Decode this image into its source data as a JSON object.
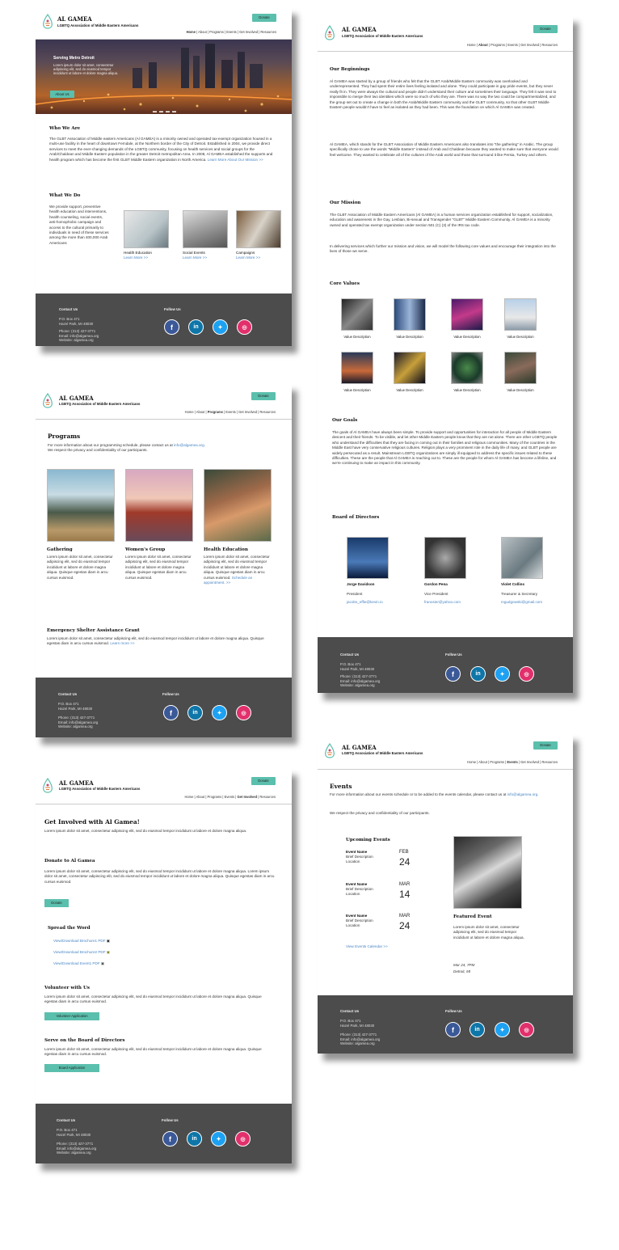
{
  "org": {
    "name": "AL GAMEA",
    "subtitle": "LGBTQ Association of Middle Eastern Americans",
    "donate": "Donate"
  },
  "nav": [
    "Home",
    "About",
    "Programs",
    "Events",
    "Get Involved",
    "Resources"
  ],
  "home": {
    "hero_title": "Serving Metro Detroit",
    "hero_text": "Lorem ipsum dolor sit amet, consectetur adipiscing elit, sed do eiusmod tempor incididunt ut labore et dolore magna aliqua.",
    "hero_button": "About Us",
    "who_title": "Who We Are",
    "who_text": "The GLBT Association of Middle eastern Americans (Al GAMEA) is a minority owned and operated tax-exempt organization housed in a multi-use facility in the heart of downtown Ferndale, at the Northern border of the City of Detroit. Established in 2004, we provide direct services to meet the ever-changing demands of the LGBTQ community, focusing on health services and social groups for the Arab/Chaldean and Middle Eastern population in the greater Detroit metropolitan Area. In 2008, Al GAMEA established the supports and health program which has become the first GLBT Middle Eastern organization in North America.",
    "who_link": "Learn More About Our Mission >>",
    "what_title": "What We Do",
    "what_text": "We provide support, preventive health education and interventions, health counseling, social events, anti-homophobic campaign and access to the cultural primarily to individuals in need of these services among the more than 400,000 Arab Americans",
    "cards": [
      {
        "label": "Health Education",
        "link": "Learn More >>"
      },
      {
        "label": "Social Events",
        "link": "Learn More >>"
      },
      {
        "label": "Campaigns",
        "link": "Learn More >>"
      }
    ]
  },
  "about": {
    "beginnings_title": "Our Beginnings",
    "beginnings_p1": "Al GAMEA was started by a group of friends who felt that the GLBT Arab/Middle Eastern community was overlooked and underrepresented. They had spent their entire lives feeling isolated and alone. They could participate in gay pride events, but they never really fit in. They were always the cultural and people didn't understand their culture and sometimes their language. They felt it was next to impossible to merge their two identities which were so much of who they are. There was no way the two could be compartmentalized, and the group set out to create a change in both the Arab/Middle Eastern community and the GLBT community, so that other GLBT Middle Eastern people wouldn't have to feel as isolated as they had been. This was the foundation on which Al GAMEA was created.",
    "beginnings_p2": "Al GAMEA, which stands for the GLBT Association of Middle Eastern Americans also translates into \"the gathering\" in Arabic. The group specifically chose to use the words \"Middle Eastern\" instead of Arab and Chaldean because they wanted to make sure that everyone would feel welcome. They wanted to celebrate all of the cultures of the Arab world and those that surround it like Persia, Turkey and others.",
    "mission_title": "Our Mission",
    "mission_p1": "The GLBT Association of Middle Eastern Americans (Al GAMEA) is a human services organization established for support, socialization, education and awareness in the Gay, Lesbian, Bi-sexual and Transgender \"GLBT\" Middle Eastern Community. Al GAMEA is a minority owned and operated tax exempt organization under section 501 (C) (3) of the IRS tax code.",
    "mission_p2": "In delivering services which further our mission and vision, we will model the following core values and encourage their integration into the lives of those we serve.",
    "values_title": "Core Values",
    "value_label": "Value Description",
    "goals_title": "Our Goals",
    "goals_text": "The goals of Al GAMEA have always been simple. To provide support and opportunities for interaction for all people of Middle Eastern descent and their friends. To be visible, and let other Middle Eastern people know that they are not alone. There are other LGBTQ people who understand the difficulties that they are facing in coming out in their families and religious communities. Many of the countries in the Middle East have very conservative religious cultures. Religion plays a very prominent role in the daily life of many, and GLBT people are widely persecuted as a result. Mainstream LGBTQ organizations are simply ill equipped to address the specific issues related to these difficulties. These are the people that Al GAMEA is reaching out to. These are the people for whom Al GAMEA has become a lifeline, and we're continuing to make an impact in this community.",
    "board_title": "Board of Directors",
    "board": [
      {
        "name": "Jorge Davidson",
        "role": "President",
        "email": "jacobs_effie@kevin.io"
      },
      {
        "name": "Gordon Pena",
        "role": "Vice President",
        "email": "franosier@yahoo.com"
      },
      {
        "name": "Violet Collins",
        "role": "Treasurer & Secretary",
        "email": "mgudgowski@gmail.com"
      }
    ]
  },
  "programs": {
    "title": "Programs",
    "intro": "For more information about our programming schedule, please contact us at",
    "intro_email": "info@algamea.org.",
    "intro2": "We respect the privacy and confidentiality of our participants.",
    "items": [
      {
        "title": "Gathering",
        "text": "Lorem ipsum dolor sit amet, consectetur adipiscing elit, sed do eiusmod tempor incididunt ut labore et dolore magna aliqua. Quisque egestas diam in arcu cursus euismod."
      },
      {
        "title": "Women's Group",
        "text": "Lorem ipsum dolor sit amet, consectetur adipiscing elit, sed do eiusmod tempor incididunt ut labore et dolore magna aliqua. Quisque egestas diam in arcu cursus euismod."
      },
      {
        "title": "Health Education",
        "text": "Lorem ipsum dolor sit amet, consectetur adipiscing elit, sed do eiusmod tempor incididunt ut labore et dolore magna aliqua. Quisque egestas diam in arcu cursus euismod.",
        "link": "Schedule an appointment. >>"
      }
    ],
    "grant_title": "Emergency Shelter Assistance Grant",
    "grant_text": "Lorem ipsum dolor sit amet, consectetur adipiscing elit, sed do eiusmod tempor incididunt ut labore et dolore magna aliqua. Quisque egestas diam in arcu cursus euismod.",
    "grant_link": "Learn more >>"
  },
  "involved": {
    "title": "Get Involved with Al Gamea!",
    "intro": "Lorem ipsum dolor sit amet, consectetur adipiscing elit, sed do eiusmod tempor incididunt ut labore et dolore magna aliqua.",
    "donate_title": "Donate to Al Gamea",
    "donate_text": "Lorem ipsum dolor sit amet, consectetur adipiscing elit, sed do eiusmod tempor incididunt ut labore et dolore magna aliqua. Lorem ipsum dolor sit amet, consectetur adipiscing elit, sed do eiusmod tempor incididunt ut labore et dolore magna aliqua. Quisque egestas diam in arcu cursus euismod.",
    "donate_button": "Donate",
    "spread_title": "Spread the Word",
    "downloads": [
      "View/Download Brochure1 PDF",
      "View/Download Brochure2 PDF",
      "View/Download Event1 PDF"
    ],
    "volunteer_title": "Volunteer with Us",
    "volunteer_text": "Lorem ipsum dolor sit amet, consectetur adipiscing elit, sed do eiusmod tempor incididunt ut labore et dolore magna aliqua. Quisque egestas diam in arcu cursus euismod.",
    "volunteer_button": "Volunteer Application",
    "board_title": "Serve on the Board of Directors",
    "board_text": "Lorem ipsum dolor sit amet, consectetur adipiscing elit, sed do eiusmod tempor incididunt ut labore et dolore magna aliqua. Quisque egestas diam in arcu cursus euismod.",
    "board_button": "Board Application"
  },
  "events": {
    "title": "Events",
    "intro": "For more information about our events schedule or to be added to the events calendar, please contact us at",
    "intro_email": "info@algamea.org.",
    "intro2": "We respect the privacy and confidentiality of our participants.",
    "upcoming_title": "Upcoming Events",
    "list": [
      {
        "name": "Event Name",
        "desc": "Brief Description",
        "loc": "Location",
        "month": "FEB",
        "day": "24"
      },
      {
        "name": "Event Name",
        "desc": "Brief Description",
        "loc": "Location",
        "month": "MAR",
        "day": "14"
      },
      {
        "name": "Event Name",
        "desc": "Brief Description",
        "loc": "Location",
        "month": "MAR",
        "day": "24"
      }
    ],
    "calendar_link": "View Events Calendar >>",
    "featured_title": "Featured Event",
    "featured_text": "Lorem ipsum dolor sit amet, consectetur adipiscing elit, sed do eiusmod tempor incididunt ut labore et dolore magna aliqua.",
    "featured_date": "Mar 24, 7PM",
    "featured_place": "Detroit, MI"
  },
  "footer": {
    "contact_title": "Contact Us",
    "po": "P.O. Box 471",
    "city": "Hazel Park, MI 48030",
    "phone": "Phone: (313) 427-3771",
    "email": "Email: info@algamea.org",
    "website": "Website: algamea.org",
    "follow_title": "Follow Us"
  },
  "colors": {
    "accent": "#5bbfad",
    "footer": "#4c4c4c",
    "link": "#4a86c5"
  }
}
